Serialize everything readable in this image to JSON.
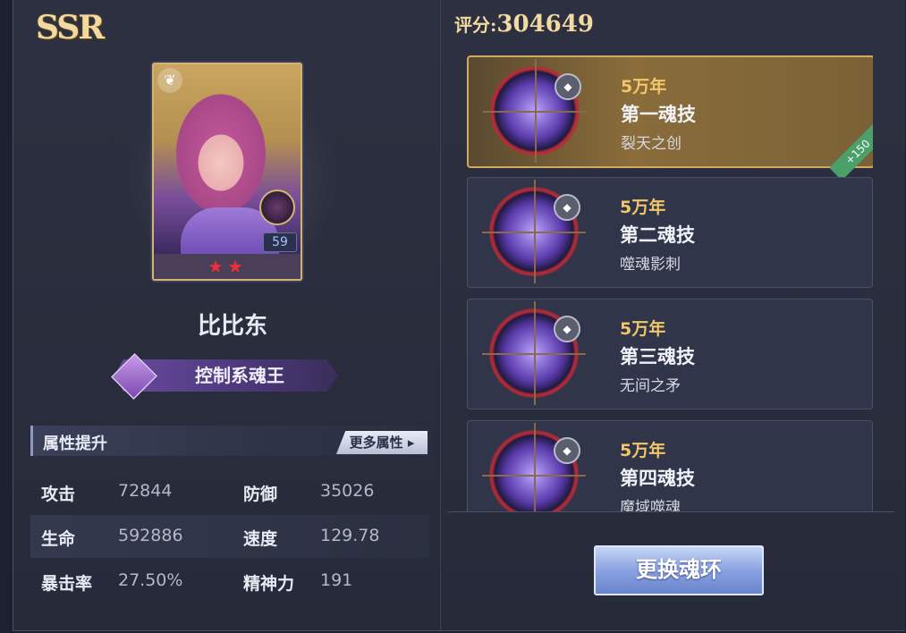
{
  "rarity": "SSR",
  "character": {
    "name": "比比东",
    "title": "控制系魂王",
    "level": "59",
    "stars": "★★"
  },
  "attributes": {
    "header": "属性提升",
    "more_label": "更多属性",
    "rows": [
      {
        "l1": "攻击",
        "v1": "72844",
        "l2": "防御",
        "v2": "35026"
      },
      {
        "l1": "生命",
        "v1": "592886",
        "l2": "速度",
        "v2": "129.78"
      },
      {
        "l1": "暴击率",
        "v1": "27.50%",
        "l2": "精神力",
        "v2": "191"
      }
    ]
  },
  "score": {
    "label": "评分:",
    "value": "304649"
  },
  "skills": [
    {
      "years": "5万年",
      "name": "第一魂技",
      "desc": "裂天之创",
      "bonus": "+150"
    },
    {
      "years": "5万年",
      "name": "第二魂技",
      "desc": "噬魂影刺"
    },
    {
      "years": "5万年",
      "name": "第三魂技",
      "desc": "无间之矛"
    },
    {
      "years": "5万年",
      "name": "第四魂技",
      "desc": "魔域噬魂"
    }
  ],
  "actions": {
    "change_ring": "更换魂环"
  },
  "icons": {
    "class": "flower-icon",
    "gem": "gem-icon",
    "more": "chevron-right-icon"
  }
}
